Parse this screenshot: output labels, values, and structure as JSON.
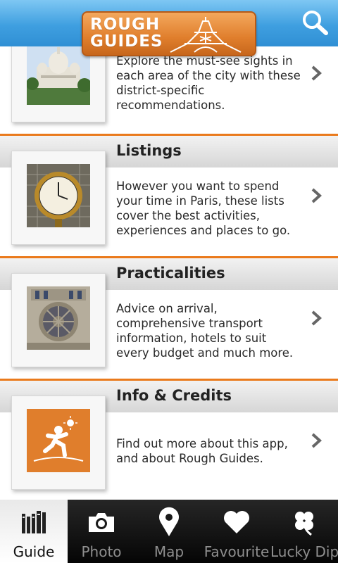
{
  "app": {
    "logo_text_line1": "ROUGH",
    "logo_text_line2": "GUIDES",
    "brand_color": "#e07e2c",
    "header_color": "#3f9fe0"
  },
  "list": {
    "items": [
      {
        "title": "",
        "description": "Explore the must-see sights in each area of the city with these district-specific recommendations.",
        "image": "sacre-coeur-photo"
      },
      {
        "title": "Listings",
        "description": "However you want to spend your time in Paris, these lists cover the best activities, experiences and places to go.",
        "image": "orsay-clock-photo"
      },
      {
        "title": "Practicalities",
        "description": "Advice on arrival, comprehensive transport information, hotels to suit every budget and much more.",
        "image": "notre-dame-rose-window-photo"
      },
      {
        "title": "Info & Credits",
        "description": "Find out more about this app, and about Rough Guides.",
        "image": "rough-guides-runner-icon"
      }
    ]
  },
  "nav": {
    "tabs": [
      {
        "label": "Guide",
        "icon": "books-icon",
        "active": true
      },
      {
        "label": "Photo",
        "icon": "camera-icon",
        "active": false
      },
      {
        "label": "Map",
        "icon": "map-pin-icon",
        "active": false
      },
      {
        "label": "Favourite",
        "icon": "heart-icon",
        "active": false
      },
      {
        "label": "Lucky Dip",
        "icon": "clover-icon",
        "active": false
      }
    ]
  }
}
